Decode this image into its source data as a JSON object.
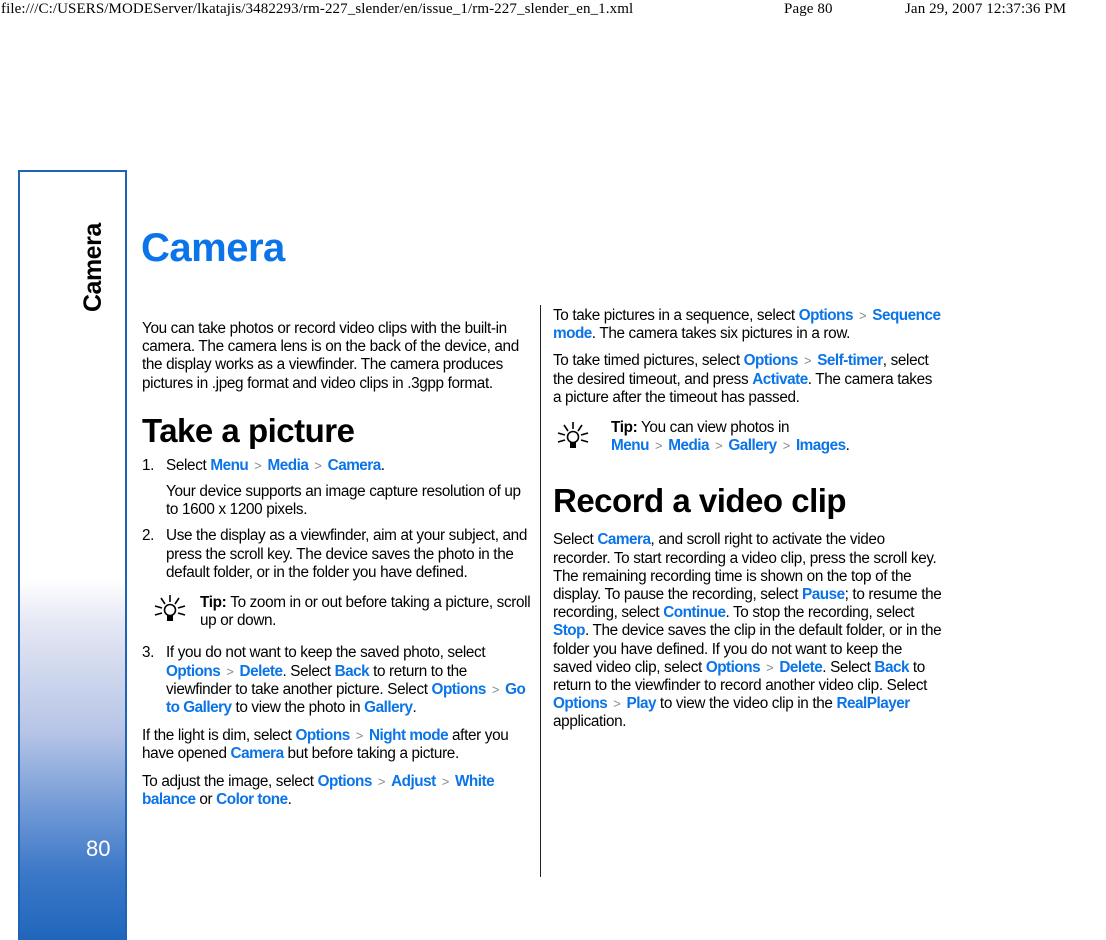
{
  "header": {
    "path": "file:///C:/USERS/MODEServer/lkatajis/3482293/rm-227_slender/en/issue_1/rm-227_slender_en_1.xml",
    "page": "Page 80",
    "date": "Jan 29, 2007 12:37:36 PM"
  },
  "sidebar": {
    "chapter": "Camera",
    "page_number": "80"
  },
  "colors": {
    "accent": "#0a74e8",
    "sidebar_border": "#1f63b9",
    "sidebar_bottom": "#1e66bb"
  },
  "title": "Camera",
  "intro": "You can take photos or record video clips with the built-in camera. The camera lens is on the back of the device, and the display works as a viewfinder. The camera produces pictures in .jpeg format and video clips in .3gpp format.",
  "take_picture": {
    "heading": "Take a picture",
    "steps": [
      {
        "num": "1.",
        "t1": "Select ",
        "l1": "Menu",
        "l2": "Media",
        "l3": "Camera",
        "t2": ".",
        "sub": "Your device supports an image capture resolution of up to 1600 x 1200 pixels."
      },
      {
        "num": "2.",
        "text": "Use the display as a viewfinder, aim at your subject, and press the scroll key. The device saves the photo in the default folder, or in the folder you have defined.",
        "tip_label": "Tip: ",
        "tip_text": " To zoom in or out before taking a picture, scroll up or down."
      },
      {
        "num": "3.",
        "t1": "If you do not want to keep the saved photo, select ",
        "l1": "Options",
        "l2": "Delete",
        "t2": ". Select ",
        "l3": "Back",
        "t3": " to return to the viewfinder to take another picture. Select ",
        "l4": "Options",
        "l5": "Go to Gallery",
        "t4": " to view the photo in ",
        "l6": "Gallery",
        "t5": "."
      }
    ],
    "dim": {
      "t1": "If the light is dim, select ",
      "l1": "Options",
      "l2": "Night mode",
      "t2": " after you have opened ",
      "l3": "Camera",
      "t3": " but before taking a picture."
    },
    "adjust": {
      "t1": "To adjust the image, select ",
      "l1": "Options",
      "l2": "Adjust",
      "l3": "White balance",
      "t2": " or ",
      "l4": "Color tone",
      "t3": "."
    }
  },
  "sequence": {
    "t1": "To take pictures in a sequence, select ",
    "l1": "Options",
    "l2": "Sequence mode",
    "t2": ". The camera takes six pictures in a row."
  },
  "timed": {
    "t1": "To take timed pictures, select ",
    "l1": "Options",
    "l2": "Self-timer",
    "t2": ", select the desired timeout, and press ",
    "l3": "Activate",
    "t3": ". The camera takes a picture after the timeout has passed."
  },
  "tip2": {
    "label": "Tip:",
    "t1": " You can view photos in ",
    "l1": "Menu",
    "l2": "Media",
    "l3": "Gallery",
    "l4": "Images",
    "t2": "."
  },
  "record": {
    "heading": "Record a video clip",
    "t1": "Select ",
    "l1": "Camera",
    "t2": ", and scroll right to activate the video recorder. To start recording a video clip, press the scroll key. The remaining recording time is shown on the top of the display. To pause the recording, select ",
    "l2": "Pause",
    "t3": "; to resume the recording, select ",
    "l3": "Continue",
    "t4": ". To stop the recording, select ",
    "l4": "Stop",
    "t5": ". The device saves the clip in the default folder, or in the folder you have defined. If you do not want to keep the saved video clip, select ",
    "l5": "Options",
    "l6": "Delete",
    "t6": ". Select ",
    "l7": "Back",
    "t7": " to return to the viewfinder to record another video clip. Select ",
    "l8": "Options",
    "l9": "Play",
    "t8": " to view the video clip in the ",
    "l10": "RealPlayer",
    "t9": " application."
  },
  "separator": ">"
}
